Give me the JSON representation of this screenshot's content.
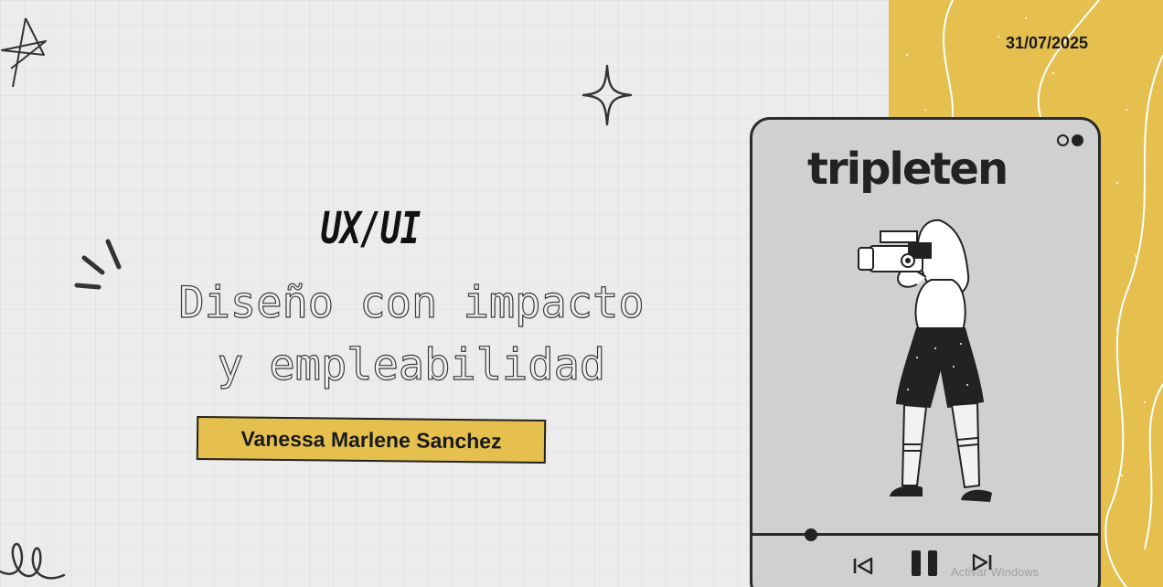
{
  "slide": {
    "date": "31/07/2025",
    "title": "UX/UI",
    "subtitle_line1": "Diseño con impacto",
    "subtitle_line2": "y empleabilidad",
    "author": "Vanessa Marlene Sanchez"
  },
  "player": {
    "brand": "tripleten",
    "progress": 0.17,
    "controls": [
      "previous-icon",
      "pause-icon",
      "next-icon"
    ]
  },
  "os_overlay": {
    "watermark": "Activar Windows"
  },
  "colors": {
    "accent_yellow": "#e5c04f",
    "ink": "#1a1a1a",
    "background": "#ececec"
  },
  "icons": [
    "star-doodle-icon",
    "sparkle-icon",
    "burst-lines-icon",
    "loop-doodle-icon",
    "camera-person-illustration"
  ]
}
